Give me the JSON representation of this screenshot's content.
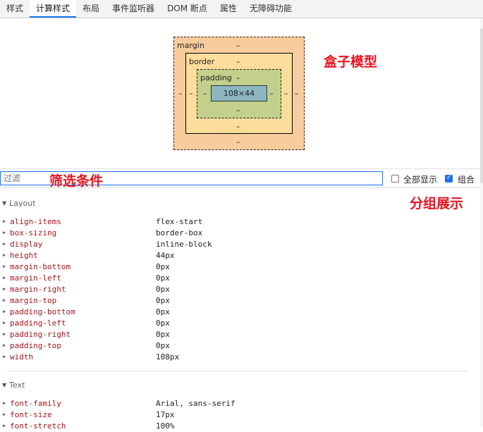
{
  "tabs": [
    "样式",
    "计算样式",
    "布局",
    "事件监听器",
    "DOM 断点",
    "属性",
    "无障碍功能"
  ],
  "active_tab": 1,
  "box_model": {
    "margin_label": "margin",
    "border_label": "border",
    "padding_label": "padding",
    "content_size": "108×44",
    "placeholder": "–"
  },
  "annotations": {
    "box_model": "盒子模型",
    "filter": "筛选条件",
    "grouping": "分组展示"
  },
  "filter": {
    "placeholder": "过滤"
  },
  "options": {
    "show_all_label": "全部显示",
    "show_all_checked": false,
    "group_label": "组合",
    "group_checked": true
  },
  "groups": [
    {
      "name": "Layout",
      "properties": [
        {
          "name": "align-items",
          "value": "flex-start"
        },
        {
          "name": "box-sizing",
          "value": "border-box"
        },
        {
          "name": "display",
          "value": "inline-block"
        },
        {
          "name": "height",
          "value": "44px"
        },
        {
          "name": "margin-bottom",
          "value": "0px"
        },
        {
          "name": "margin-left",
          "value": "0px"
        },
        {
          "name": "margin-right",
          "value": "0px"
        },
        {
          "name": "margin-top",
          "value": "0px"
        },
        {
          "name": "padding-bottom",
          "value": "0px"
        },
        {
          "name": "padding-left",
          "value": "0px"
        },
        {
          "name": "padding-right",
          "value": "0px"
        },
        {
          "name": "padding-top",
          "value": "0px"
        },
        {
          "name": "width",
          "value": "108px"
        }
      ]
    },
    {
      "name": "Text",
      "properties": [
        {
          "name": "font-family",
          "value": "Arial, sans-serif"
        },
        {
          "name": "font-size",
          "value": "17px"
        },
        {
          "name": "font-stretch",
          "value": "100%"
        }
      ]
    }
  ],
  "colors": {
    "accent": "#1a73e8",
    "annotation": "#e8131f",
    "margin": "#f9cc9d",
    "border": "#fddd9b",
    "padding": "#c3d08b",
    "content": "#8cb6c0"
  }
}
